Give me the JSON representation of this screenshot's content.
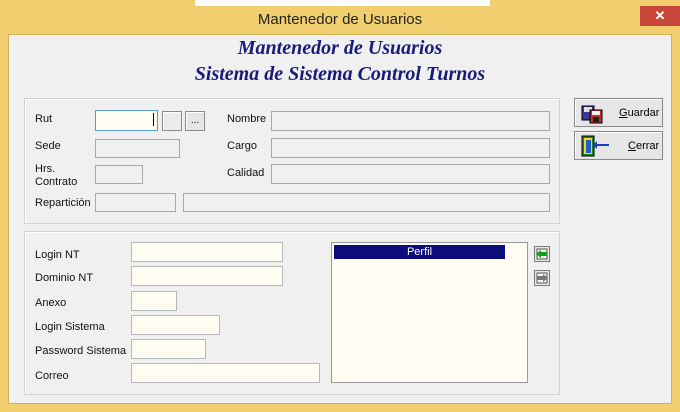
{
  "window": {
    "title": "Mantenedor de Usuarios",
    "close_glyph": "✕"
  },
  "header": {
    "line1": "Mantenedor de Usuarios",
    "line2": "Sistema de Sistema Control Turnos"
  },
  "form_top": {
    "rut_label": "Rut",
    "rut_value": "",
    "lookup_button": "...",
    "sede_label": "Sede",
    "hrs_label_1": "Hrs.",
    "hrs_label_2": "Contrato",
    "reparticion_label": "Repartición",
    "nombre_label": "Nombre",
    "cargo_label": "Cargo",
    "calidad_label": "Calidad"
  },
  "form_bottom": {
    "login_nt_label": "Login NT",
    "dominio_nt_label": "Dominio NT",
    "anexo_label": "Anexo",
    "login_sistema_label": "Login Sistema",
    "password_sistema_label": "Password Sistema",
    "correo_label": "Correo"
  },
  "perfil": {
    "header": "Perfil"
  },
  "actions": {
    "guardar_accel": "G",
    "guardar_rest": "uardar",
    "cerrar_accel": "C",
    "cerrar_rest": "errar"
  },
  "icons": {
    "save": "save-icon",
    "exit": "exit-door-icon",
    "add": "add-profile-icon",
    "remove": "remove-profile-icon",
    "close": "close-icon"
  },
  "colors": {
    "frame": "#f2cf6e",
    "heading": "#1a1a7a",
    "perfil_header": "#0c0c7a",
    "close": "#c9473b"
  }
}
